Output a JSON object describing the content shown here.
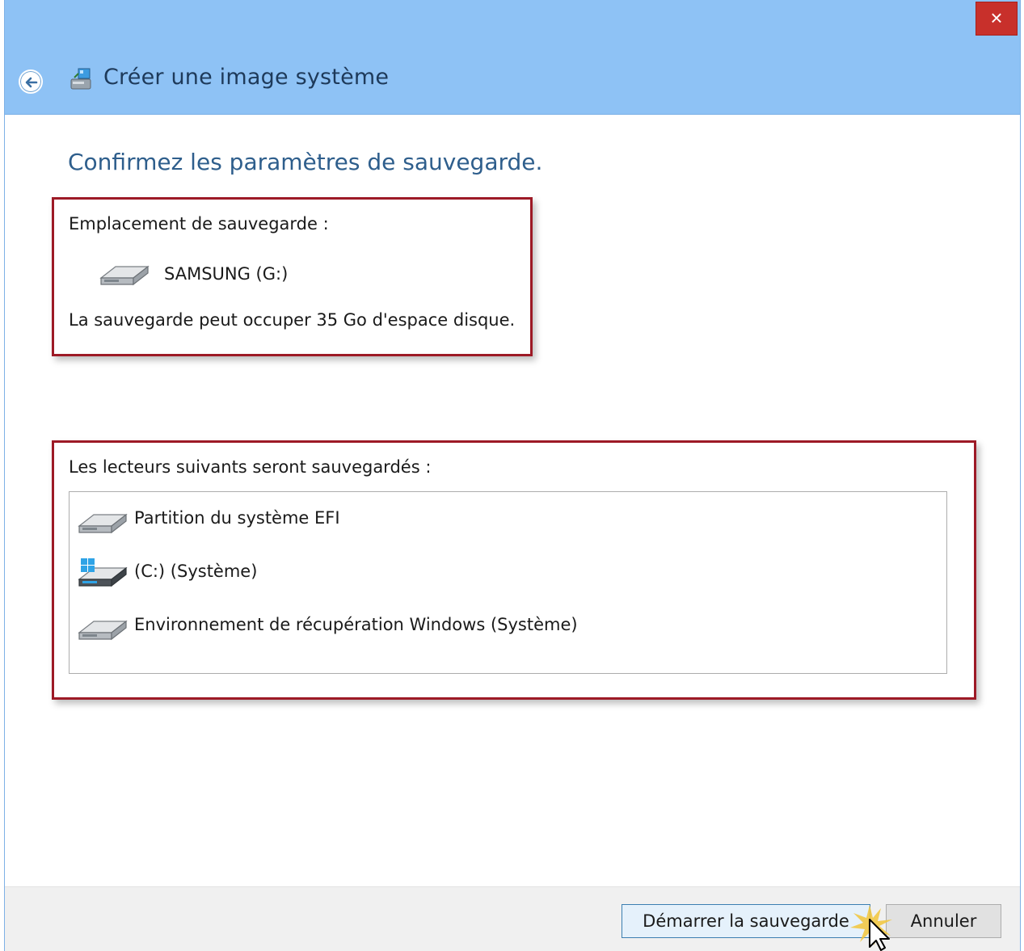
{
  "window": {
    "title": "Créer une image système",
    "close_label": "×"
  },
  "main": {
    "heading": "Confirmez les paramètres de sauvegarde."
  },
  "location": {
    "title": "Emplacement de sauvegarde :",
    "drive_name": "SAMSUNG (G:)",
    "space_note": "La sauvegarde peut occuper 35 Go d'espace disque."
  },
  "drives": {
    "title": "Les lecteurs suivants seront sauvegardés :",
    "items": [
      {
        "label": "Partition du système EFI",
        "icon": "hard-drive-icon"
      },
      {
        "label": "(C:) (Système)",
        "icon": "windows-drive-icon"
      },
      {
        "label": "Environnement de récupération Windows (Système)",
        "icon": "hard-drive-icon"
      }
    ]
  },
  "footer": {
    "start_label": "Démarrer la sauvegarde",
    "cancel_label": "Annuler"
  },
  "colors": {
    "titlebar": "#8ec2f5",
    "heading": "#2e5e8c",
    "highlight_border": "#9d1a26",
    "close": "#c8302b"
  }
}
